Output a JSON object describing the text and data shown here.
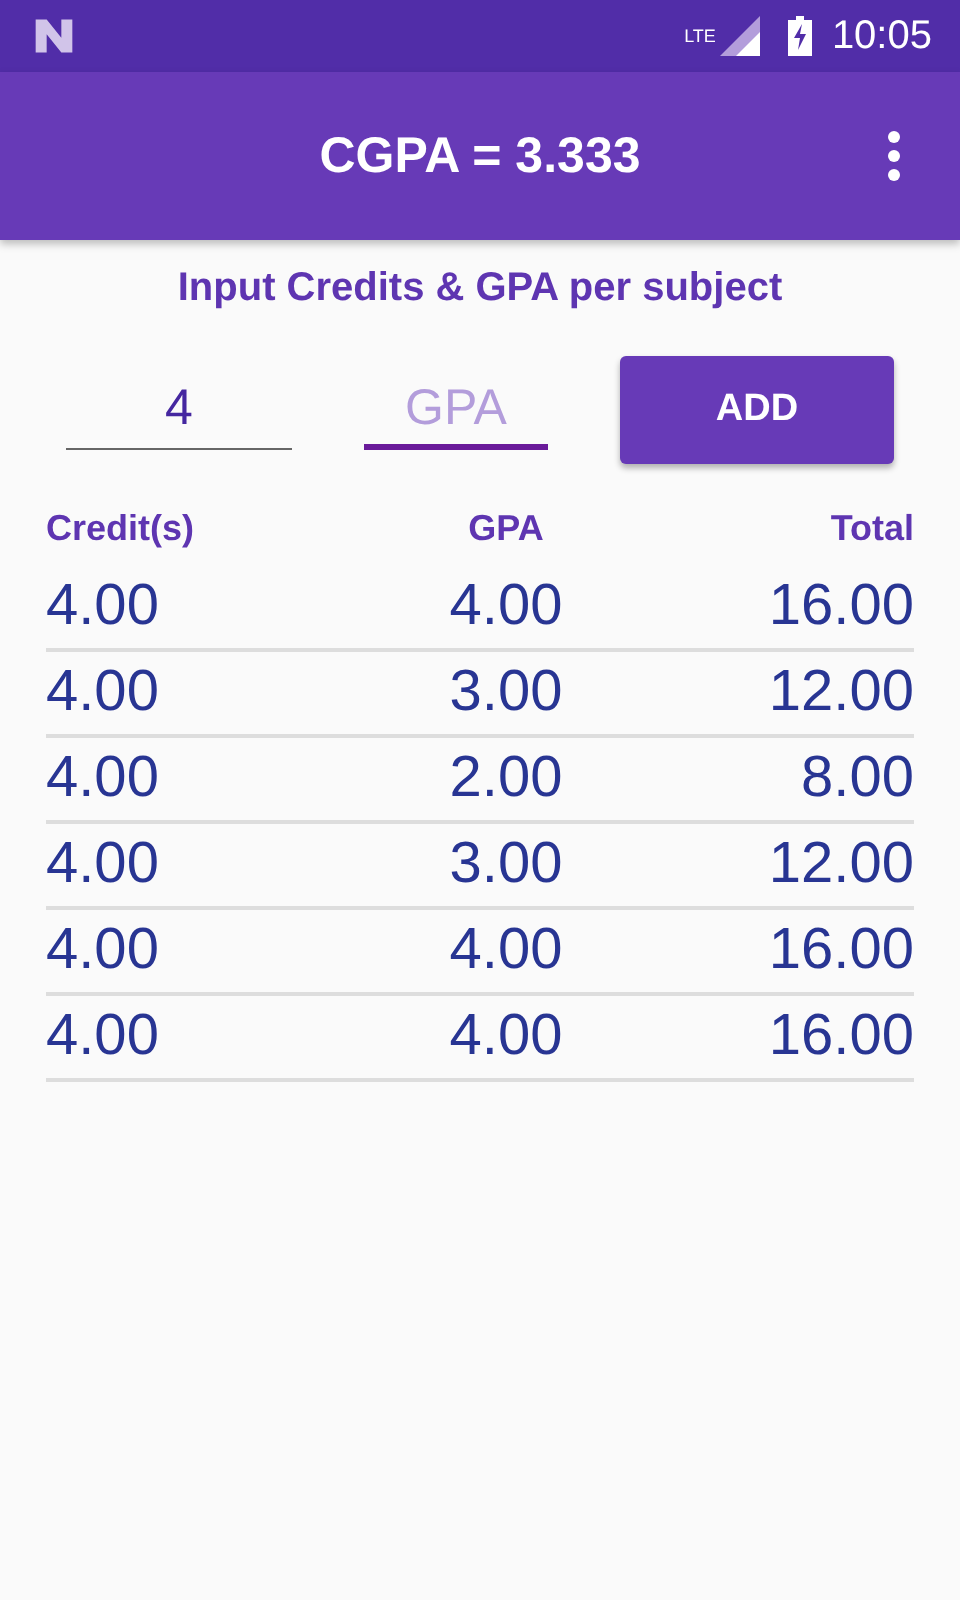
{
  "status_bar": {
    "network": "LTE",
    "time": "10:05"
  },
  "app_bar": {
    "title": "CGPA = 3.333"
  },
  "subtitle": "Input Credits & GPA per subject",
  "fields": [
    {
      "value": "4",
      "focused": false
    },
    {
      "placeholder": "GPA",
      "focused": true
    }
  ],
  "add_button": "ADD",
  "table": {
    "columns": [
      "Credit(s)",
      "GPA",
      "Total"
    ],
    "rows": [
      [
        "4.00",
        "4.00",
        "16.00"
      ],
      [
        "4.00",
        "3.00",
        "12.00"
      ],
      [
        "4.00",
        "2.00",
        "8.00"
      ],
      [
        "4.00",
        "3.00",
        "12.00"
      ],
      [
        "4.00",
        "4.00",
        "16.00"
      ],
      [
        "4.00",
        "4.00",
        "16.00"
      ]
    ]
  }
}
